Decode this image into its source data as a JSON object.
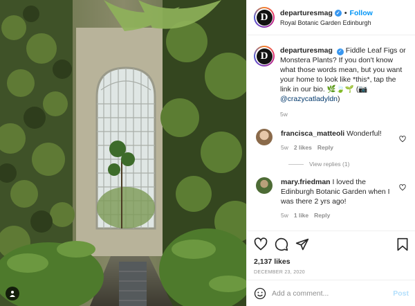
{
  "post": {
    "username": "departuresmag",
    "follow_label": "Follow",
    "separator": "•",
    "location": "Royal Botanic Garden Edinburgh",
    "avatar_letter": "D",
    "caption": {
      "text": "Fiddle Leaf Figs or Monstera Plants? If you don't know what those words mean, but you want your home to look like *this*, tap the link in our bio. 🌿🍃🌱 (📷",
      "mention": "@crazycatladyldn",
      "closing": ")",
      "time": "5w"
    },
    "comments": [
      {
        "username": "francisca_matteoli",
        "text": "Wonderful!",
        "time": "5w",
        "likes": "2 likes",
        "reply": "Reply",
        "view_replies": "View replies (1)"
      },
      {
        "username": "mary.friedman",
        "text": "I loved the Edinburgh Botanic Garden when I was there 2 yrs ago!",
        "time": "5w",
        "likes": "1 like",
        "reply": "Reply"
      }
    ],
    "likes": "2,137 likes",
    "date": "DECEMBER 23, 2020",
    "comment_placeholder": "Add a comment...",
    "post_label": "Post"
  },
  "icons": {
    "like": "heart-icon",
    "comment": "comment-icon",
    "share": "share-icon",
    "save": "bookmark-icon",
    "emoji": "emoji-icon",
    "verified": "verified-badge-icon",
    "tagged_user": "user-tag-icon"
  },
  "colors": {
    "follow": "#0095f6",
    "verified": "#3897f0",
    "post_disabled": "#b2dffc",
    "mention": "#00376b",
    "muted": "#8e8e8e"
  }
}
